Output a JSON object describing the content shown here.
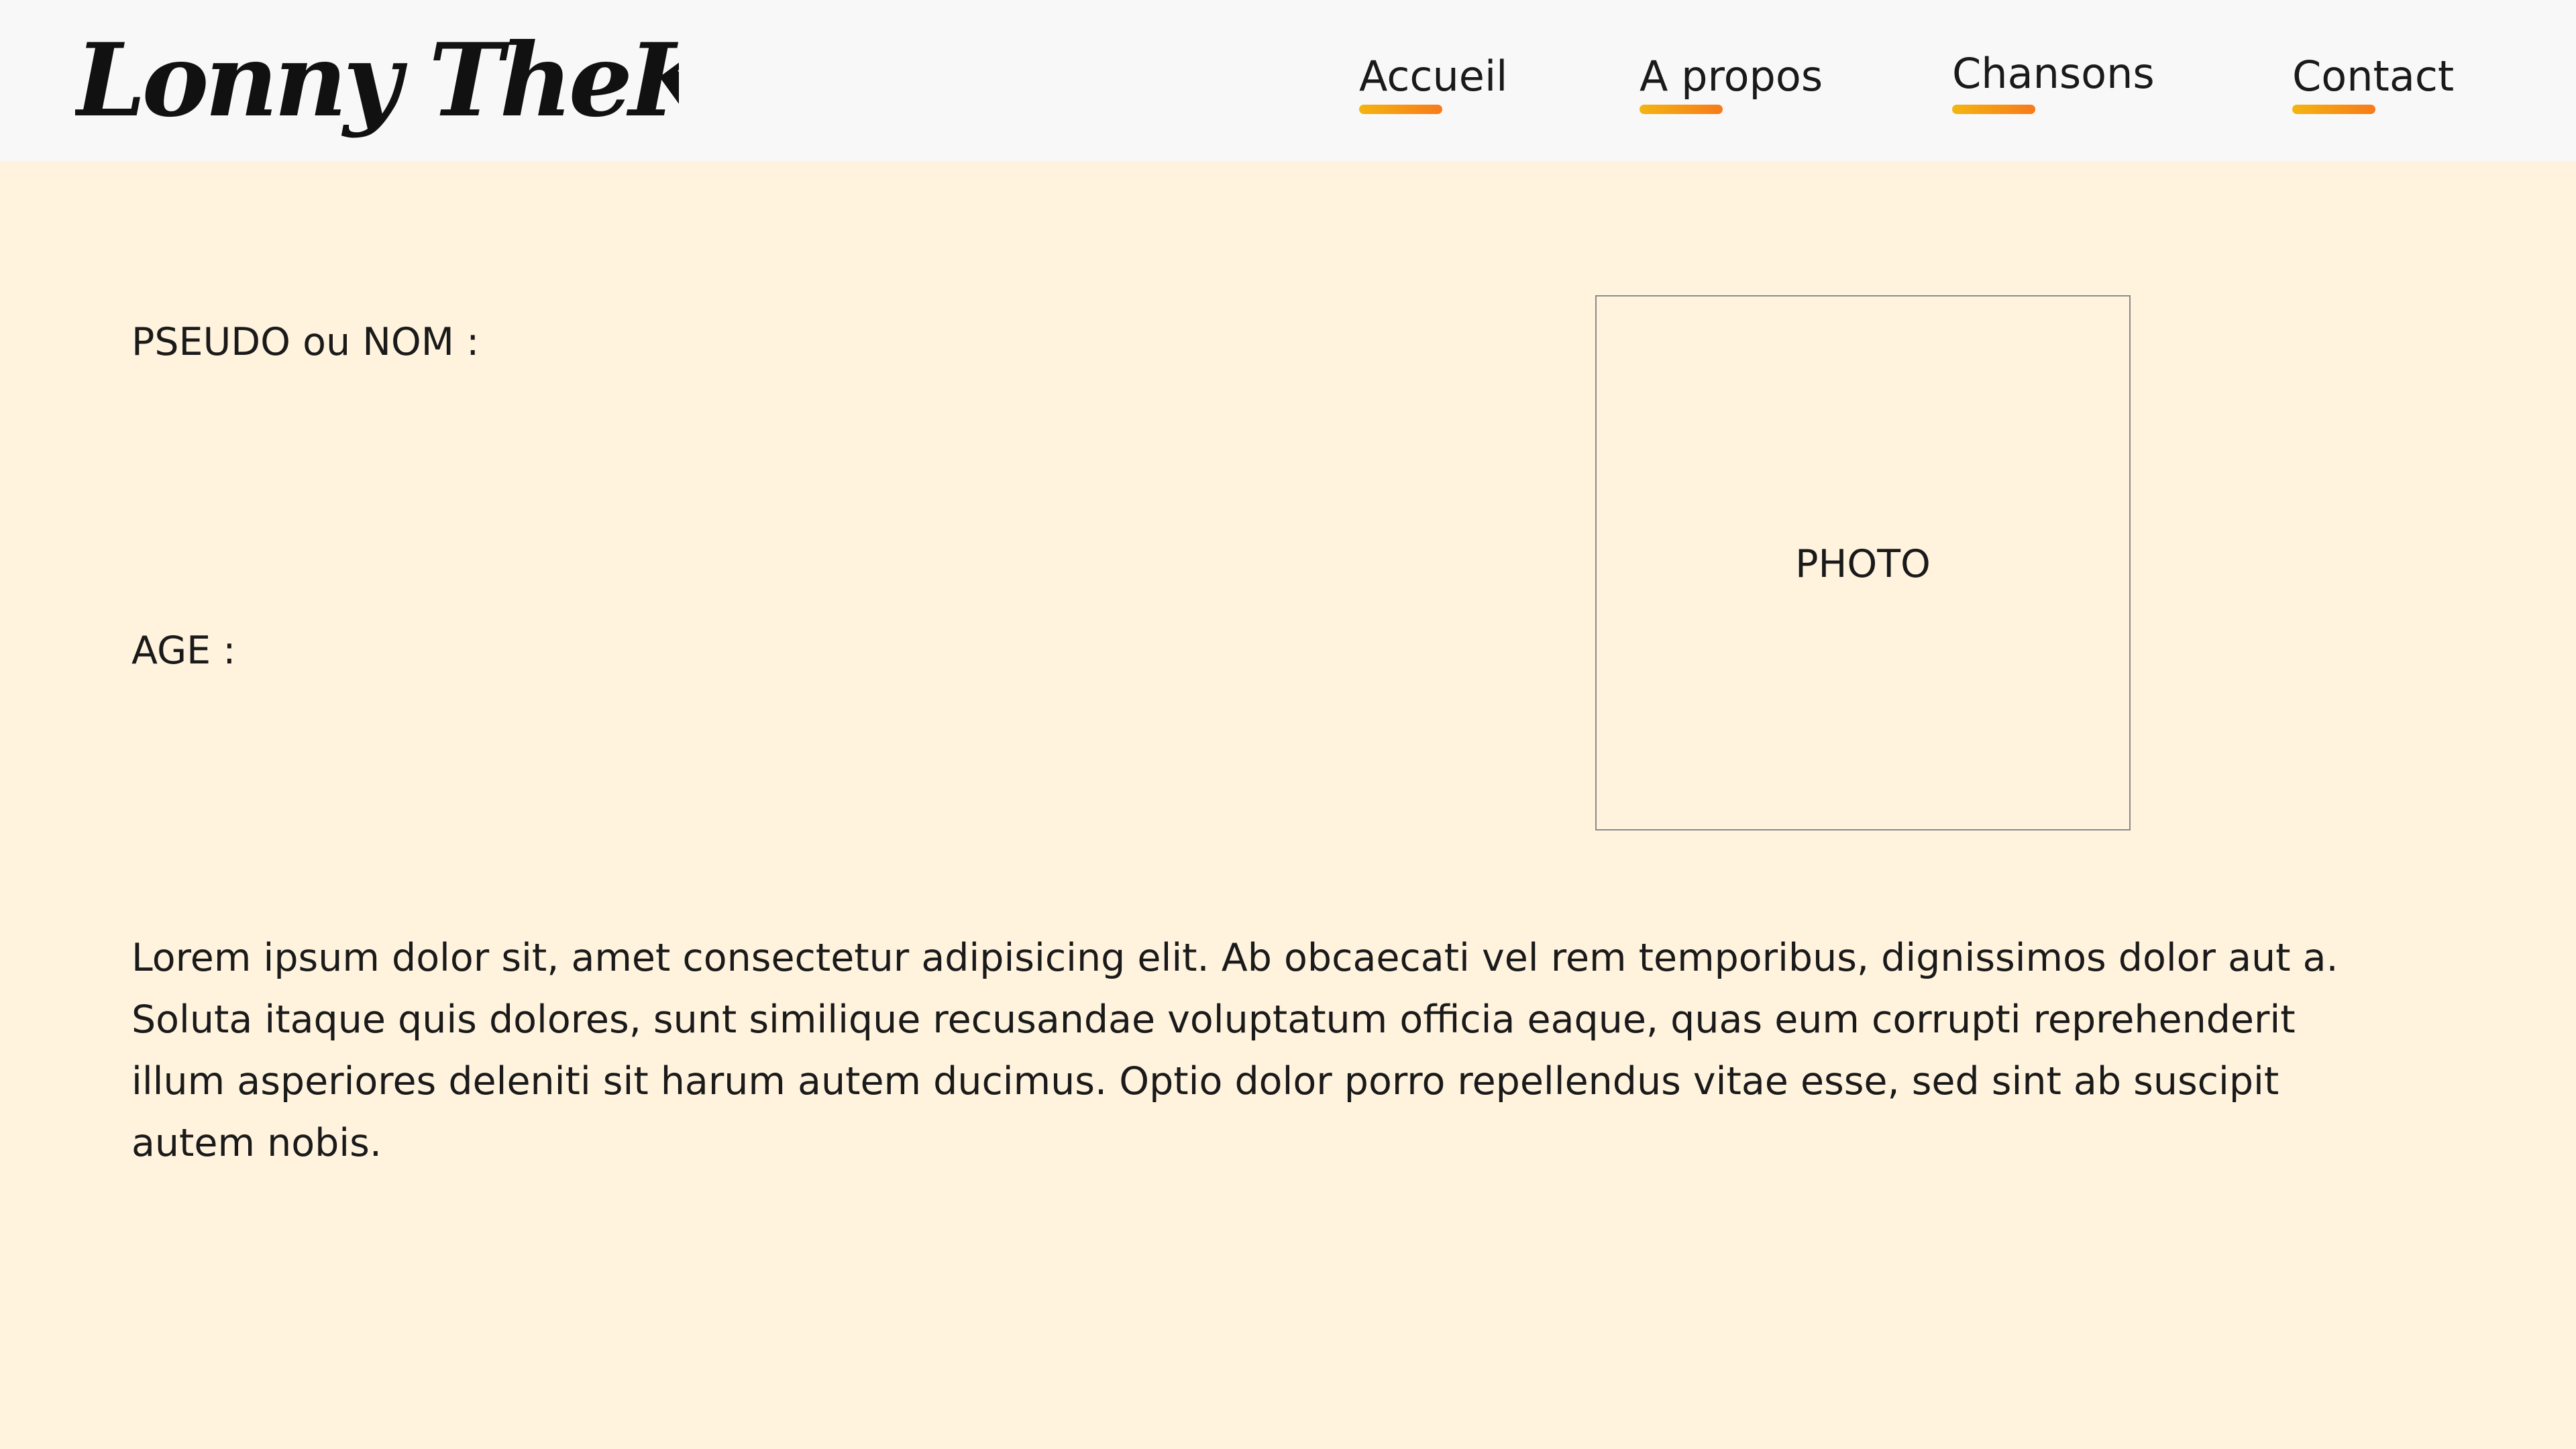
{
  "logo": {
    "text": "Lonny TheKIDD"
  },
  "nav": {
    "items": [
      {
        "label": "Accueil"
      },
      {
        "label": "A propos"
      },
      {
        "label": "Chansons"
      },
      {
        "label": "Contact"
      }
    ],
    "underline_colors": [
      "#F3B511",
      "#F77A1B"
    ]
  },
  "profile": {
    "name_label": "PSEUDO ou NOM :",
    "age_label": "AGE :",
    "photo_placeholder": "PHOTO"
  },
  "bio": {
    "lines": [
      "Lorem ipsum dolor sit, amet consectetur adipisicing elit. Ab obcaecati vel rem temporibus, dignissimos dolor aut a.",
      "Soluta itaque quis dolores, sunt similique recusandae voluptatum officia eaque, quas eum corrupti reprehenderit",
      "illum asperiores deleniti sit harum autem ducimus. Optio dolor porro repellendus vitae esse, sed sint ab suscipit",
      "autem nobis."
    ]
  },
  "colors": {
    "header_background": "#F8F8F8",
    "page_background": "#FFF3DE",
    "text": "#1a1a1a"
  }
}
